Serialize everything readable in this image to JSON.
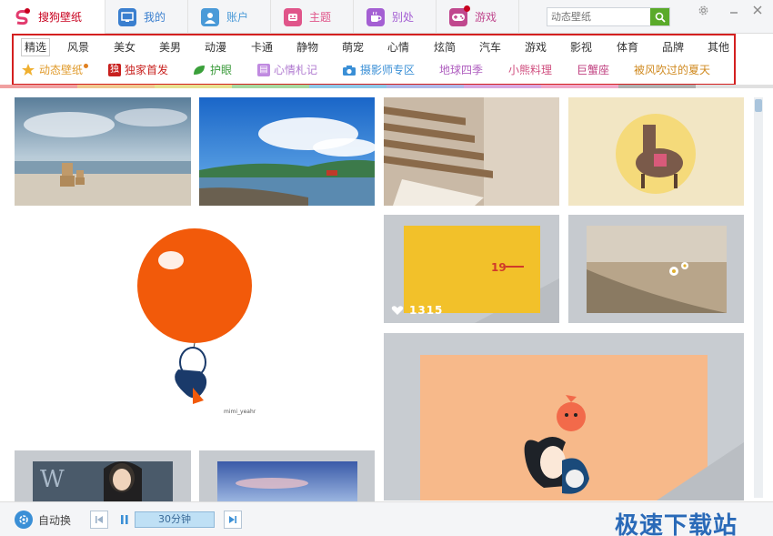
{
  "app": {
    "brand_label": "搜狗壁纸"
  },
  "tabs": [
    {
      "label": "我的",
      "color": "#3a7fcf"
    },
    {
      "label": "账户",
      "color": "#4a9ad8"
    },
    {
      "label": "主题",
      "color": "#e0558a"
    },
    {
      "label": "别处",
      "color": "#a45fd3"
    },
    {
      "label": "游戏",
      "color": "#c0488e"
    }
  ],
  "search": {
    "placeholder": "动态壁纸"
  },
  "categories": [
    "精选",
    "风景",
    "美女",
    "美男",
    "动漫",
    "卡通",
    "静物",
    "萌宠",
    "心情",
    "炫简",
    "汽车",
    "游戏",
    "影视",
    "体育",
    "品牌",
    "其他"
  ],
  "active_category": "精选",
  "sub_categories": [
    {
      "label": "动态壁纸",
      "color": "#e09a2a",
      "icon": "star-icon"
    },
    {
      "label": "独家首发",
      "color": "#c8201e",
      "icon": "exclusive-icon"
    },
    {
      "label": "护眼",
      "color": "#3a9a3a",
      "icon": "leaf-icon"
    },
    {
      "label": "心情札记",
      "color": "#b07ad0",
      "icon": "notebook-icon"
    },
    {
      "label": "摄影师专区",
      "color": "#3a8fd6",
      "icon": "camera-icon"
    },
    {
      "label": "地球四季",
      "color": "#b060c0",
      "icon": ""
    },
    {
      "label": "小熊料理",
      "color": "#d05080",
      "icon": ""
    },
    {
      "label": "巨蟹座",
      "color": "#c04080",
      "icon": ""
    },
    {
      "label": "被风吹过的夏天",
      "color": "#d08a20",
      "icon": ""
    }
  ],
  "gallery": {
    "likes_count": "1315"
  },
  "bottom": {
    "auto_label": "自动换",
    "interval_label": "30分钟"
  },
  "watermark": "极速下载站"
}
